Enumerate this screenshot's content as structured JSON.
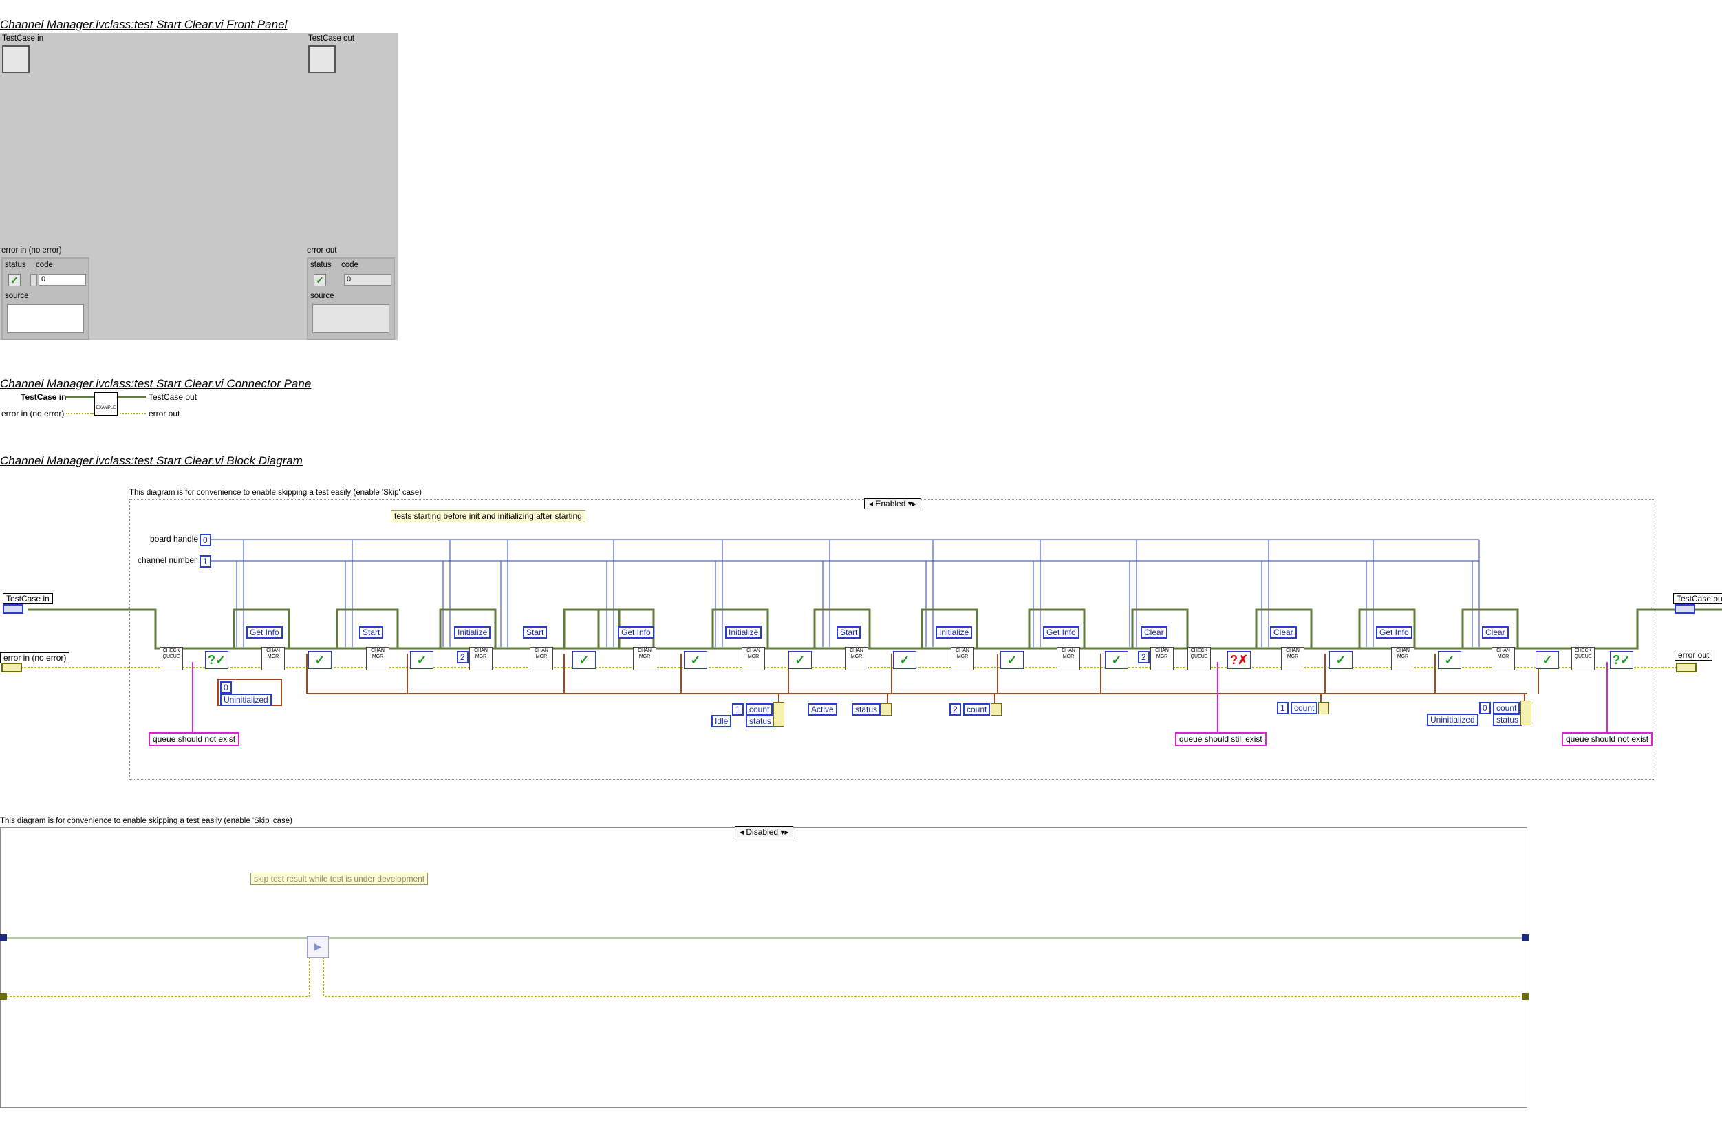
{
  "front_panel": {
    "title": "Channel Manager.lvclass:test Start Clear.vi Front Panel",
    "testcase_in_label": "TestCase in",
    "testcase_out_label": "TestCase out",
    "error_in_label": "error in (no error)",
    "error_out_label": "error out",
    "status_label": "status",
    "code_label": "code",
    "code_value": "0",
    "source_label": "source"
  },
  "connector_pane": {
    "title": "Channel Manager.lvclass:test Start Clear.vi Connector Pane",
    "testcase_in": "TestCase in",
    "testcase_out": "TestCase out",
    "error_in": "error in (no error)",
    "error_out": "error out",
    "icon_text": "EXAMPLE"
  },
  "block_diagram": {
    "title": "Channel Manager.lvclass:test Start Clear.vi Block Diagram",
    "structure1_caption": "This diagram is for convenience to enable skipping a test easily (enable 'Skip' case)",
    "structure1_case": "Enabled",
    "note1": "tests starting before init and initializing after starting",
    "board_handle_label": "board handle",
    "board_handle_value": "0",
    "channel_number_label": "channel number",
    "channel_number_value": "1",
    "testcase_in": "TestCase in",
    "error_in": "error in (no error)",
    "testcase_out": "TestCase out",
    "error_out": "error out",
    "commands": [
      "Get Info",
      "Start",
      "Initialize",
      "Start",
      "Get Info",
      "Initialize",
      "Start",
      "Initialize",
      "Get Info",
      "Clear",
      "Clear",
      "Get Info",
      "Clear"
    ],
    "vi_label": "CHAN MGR",
    "check_queue": "CHECK QUEUE",
    "const_zero": "0",
    "const_two": "2",
    "uninit_enum": "Uninitialized",
    "cluster_count_label": "count",
    "cluster_status_label": "status",
    "c1_count": "1",
    "c1_status": "Idle",
    "c2_status": "Active",
    "c3_count": "2",
    "c4_count": "1",
    "c5_count": "0",
    "c5_status": "Uninitialized",
    "comment1": "queue should not exist",
    "comment2": "queue should still exist",
    "comment3": "queue should not exist",
    "structure2_caption": "This diagram is for convenience to enable skipping a test easily (enable 'Skip' case)",
    "structure2_case": "Disabled",
    "note2": "skip test result while test is under development"
  },
  "colors": {
    "class_wire": "#5f7a3c",
    "error_wire": "#b0b020",
    "int_wire": "#2a3fcf",
    "status_wire": "#a04a20",
    "comment_border": "#e020d8"
  }
}
